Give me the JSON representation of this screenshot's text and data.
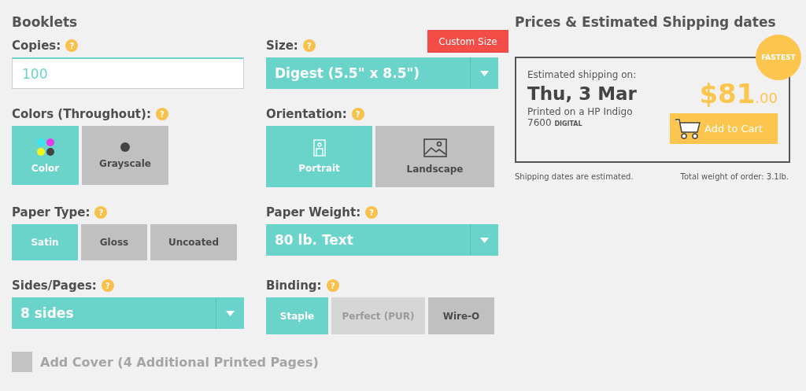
{
  "title": "Booklets",
  "custom_size_button": "Custom Size",
  "fields": [
    {
      "kind": "input",
      "label": "Copies:",
      "help": "?",
      "value": "100"
    },
    {
      "kind": "select",
      "label": "Size:",
      "help": "?",
      "value": "Digest (5.5\" x 8.5\")"
    },
    {
      "kind": "tiles",
      "label": "Colors (Throughout):",
      "help": "?",
      "options": [
        {
          "label": "Color",
          "kind": "dots",
          "selected": true,
          "disabled": false
        },
        {
          "label": "Grayscale",
          "kind": "dot",
          "selected": false,
          "disabled": false
        }
      ]
    },
    {
      "kind": "tiles",
      "label": "Orientation:",
      "help": "?",
      "options": [
        {
          "label": "Portrait",
          "kind": "portrait",
          "selected": true,
          "disabled": false
        },
        {
          "label": "Landscape",
          "kind": "landscape",
          "selected": false,
          "disabled": false
        }
      ]
    },
    {
      "kind": "buttons",
      "label": "Paper Type:",
      "help": "?",
      "options": [
        {
          "label": "Satin",
          "selected": true,
          "disabled": false
        },
        {
          "label": "Gloss",
          "selected": false,
          "disabled": false
        },
        {
          "label": "Uncoated",
          "selected": false,
          "disabled": false
        }
      ]
    },
    {
      "kind": "select",
      "label": "Paper Weight:",
      "help": "?",
      "value": "80 lb. Text"
    },
    {
      "kind": "select",
      "label": "Sides/Pages:",
      "help": "?",
      "value": "8 sides"
    },
    {
      "kind": "buttons",
      "label": "Binding:",
      "help": "?",
      "options": [
        {
          "label": "Staple",
          "selected": true,
          "disabled": false
        },
        {
          "label": "Perfect (PUR)",
          "selected": false,
          "disabled": true
        },
        {
          "label": "Wire-O",
          "selected": false,
          "disabled": false
        }
      ]
    }
  ],
  "add_cover": {
    "label": "Add Cover (4 Additional Printed Pages)",
    "checked": false
  },
  "prices": {
    "title": "Prices & Estimated Shipping dates",
    "badge": "FASTEST",
    "shipping_label": "Estimated shipping on:",
    "date": "Thu, 3 Mar",
    "printer": "Printed on a HP Indigo",
    "printer_model": "7600",
    "printer_tag": "DIGITAL",
    "price_whole": "$81",
    "price_cents": ".00",
    "cart_button": "Add to Cart",
    "note": "Shipping dates are estimated.",
    "weight": "Total weight of order: 3.1lb."
  }
}
